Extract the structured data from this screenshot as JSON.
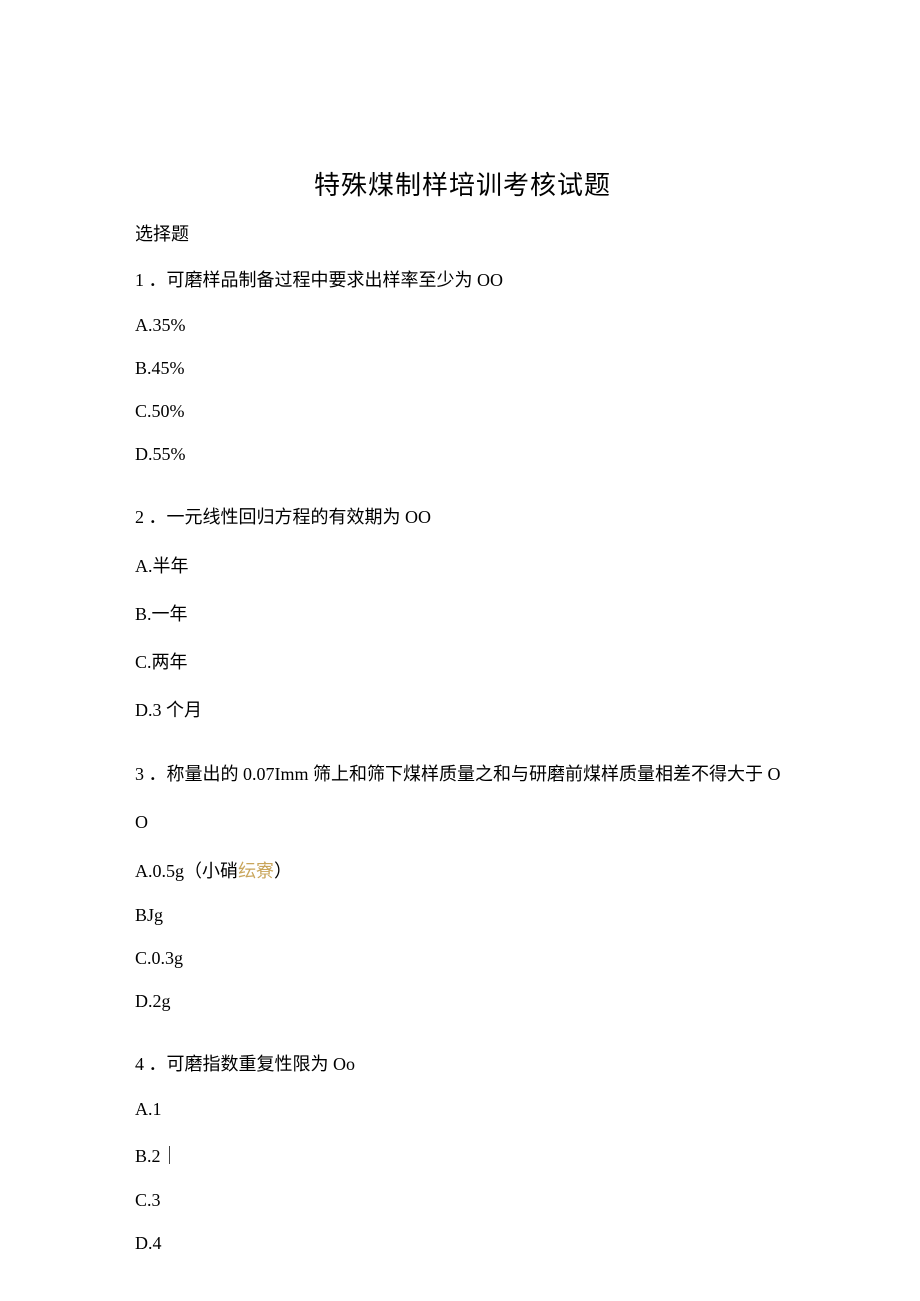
{
  "title": "特殊煤制样培训考核试题",
  "section_label": "选择题",
  "questions": [
    {
      "number": "1",
      "text": "．可磨样品制备过程中要求出样率至少为 OO",
      "options": [
        {
          "label": "A.35%"
        },
        {
          "label": "B.45%"
        },
        {
          "label": "C.50%"
        },
        {
          "label": "D.55%"
        }
      ]
    },
    {
      "number": "2",
      "text": "．一元线性回归方程的有效期为 OO",
      "options": [
        {
          "label_prefix": "A.",
          "label_cn": "半年"
        },
        {
          "label_prefix": "B.",
          "label_cn": "一年"
        },
        {
          "label_prefix": "C.",
          "label_cn": "两年"
        },
        {
          "label_prefix": "D.3 ",
          "label_cn": "个月"
        }
      ]
    },
    {
      "number": "3",
      "text_line1": "．称量出的 0.07Imm 筛上和筛下煤样质量之和与研磨前煤样质量相差不得大于 O",
      "text_line2": "O",
      "options": [
        {
          "label_prefix": "A.0.5g",
          "label_cn_paren_open": "（",
          "label_cn_mid": "小硝",
          "label_cn_highlight": "纭寮",
          "label_cn_paren_close": "）"
        },
        {
          "label": "BJg"
        },
        {
          "label": "C.0.3g"
        },
        {
          "label": "D.2g"
        }
      ]
    },
    {
      "number": "4",
      "text": "．可磨指数重复性限为 Oo",
      "options": [
        {
          "label": "A.1"
        },
        {
          "label": "B.2｜"
        },
        {
          "label": "C.3"
        },
        {
          "label": "D.4"
        }
      ]
    }
  ]
}
